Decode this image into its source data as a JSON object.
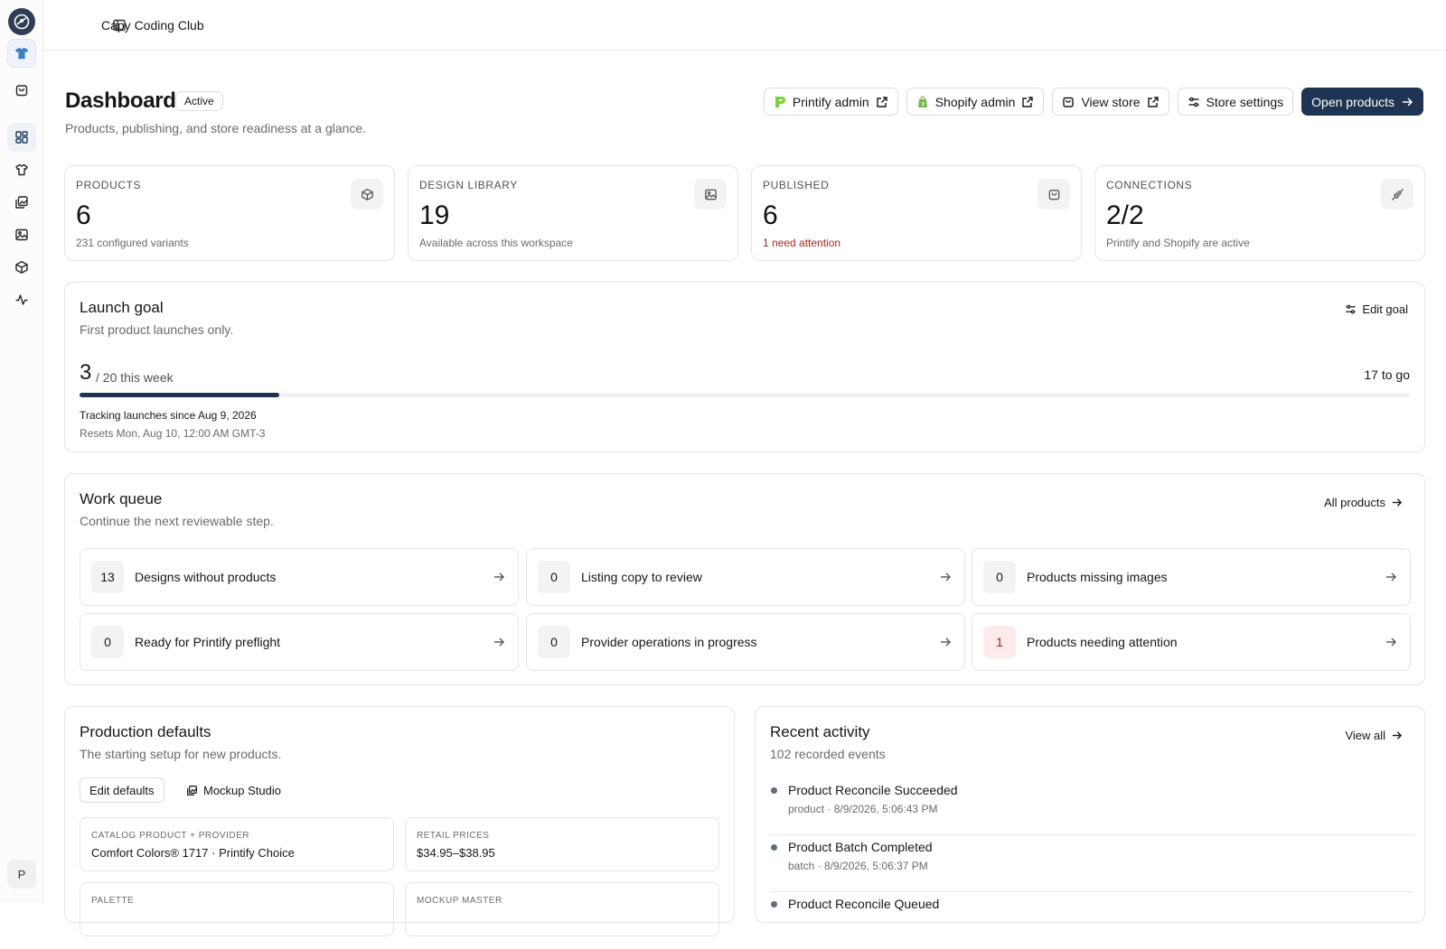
{
  "topbar": {
    "workspace_name": "Capy Coding Club"
  },
  "rail": {
    "avatar_initial": "P"
  },
  "header": {
    "title": "Dashboard",
    "status": "Active",
    "subtitle": "Products, publishing, and store readiness at a glance.",
    "actions": {
      "printify_admin": "Printify admin",
      "shopify_admin": "Shopify admin",
      "view_store": "View store",
      "store_settings": "Store settings",
      "open_products": "Open products"
    }
  },
  "stats": [
    {
      "label": "PRODUCTS",
      "value": "6",
      "note": "231 configured variants"
    },
    {
      "label": "DESIGN LIBRARY",
      "value": "19",
      "note": "Available across this workspace"
    },
    {
      "label": "PUBLISHED",
      "value": "6",
      "note": "1 need attention"
    },
    {
      "label": "CONNECTIONS",
      "value": "2/2",
      "note": "Printify and Shopify are active"
    }
  ],
  "launch_goal": {
    "title": "Launch goal",
    "subtitle": "First product launches only.",
    "edit_label": "Edit goal",
    "count": "3",
    "target_text": "/ 20 this week",
    "to_go": "17 to go",
    "progress_fraction": 0.15,
    "since": "Tracking launches since Aug 9, 2026",
    "resets": "Resets Mon, Aug 10, 12:00 AM GMT-3"
  },
  "work_queue": {
    "title": "Work queue",
    "subtitle": "Continue the next reviewable step.",
    "all_products_label": "All products",
    "items": [
      {
        "count": "13",
        "label": "Designs without products"
      },
      {
        "count": "0",
        "label": "Listing copy to review"
      },
      {
        "count": "0",
        "label": "Products missing images"
      },
      {
        "count": "0",
        "label": "Ready for Printify preflight"
      },
      {
        "count": "0",
        "label": "Provider operations in progress"
      },
      {
        "count": "1",
        "label": "Products needing attention"
      }
    ]
  },
  "production_defaults": {
    "title": "Production defaults",
    "subtitle": "The starting setup for new products.",
    "edit_label": "Edit defaults",
    "mockup_label": "Mockup Studio",
    "fields": [
      {
        "label": "CATALOG PRODUCT + PROVIDER",
        "value": "Comfort Colors® 1717 · Printify Choice"
      },
      {
        "label": "RETAIL PRICES",
        "value": "$34.95–$38.95"
      },
      {
        "label": "PALETTE",
        "value": ""
      },
      {
        "label": "MOCKUP MASTER",
        "value": ""
      }
    ]
  },
  "recent_activity": {
    "title": "Recent activity",
    "subtitle": "102 recorded events",
    "view_all_label": "View all",
    "events": [
      {
        "title": "Product Reconcile Succeeded",
        "meta": "product · 8/9/2026, 5:06:43 PM"
      },
      {
        "title": "Product Batch Completed",
        "meta": "batch · 8/9/2026, 5:06:37 PM"
      },
      {
        "title": "Product Reconcile Queued",
        "meta": ""
      }
    ]
  },
  "colors": {
    "primary": "#1f3352",
    "warn": "#b42318",
    "border": "#e5e5e5"
  }
}
